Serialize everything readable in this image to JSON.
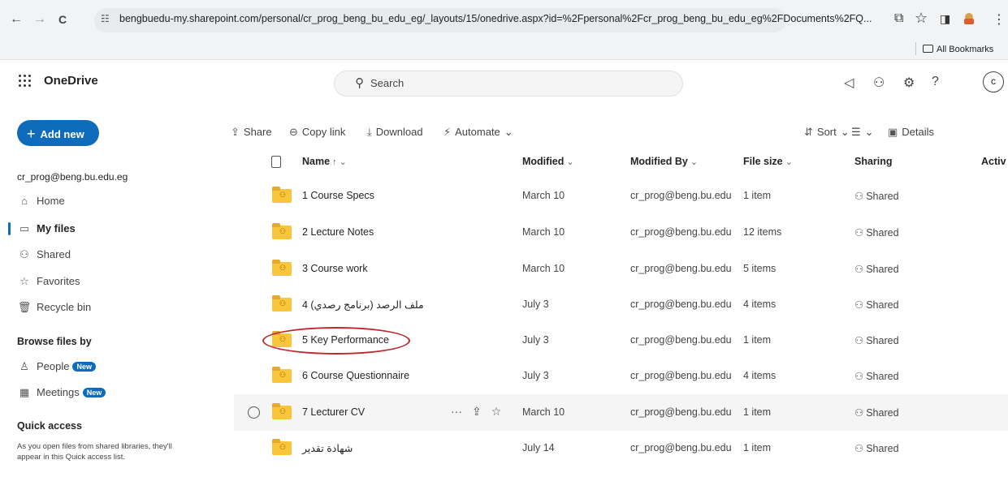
{
  "browser": {
    "back_icon": "←",
    "forward_icon": "→",
    "reload_icon": "C",
    "site_icon": "☷",
    "url": "bengbuedu-my.sharepoint.com/personal/cr_prog_beng_bu_edu_eg/_layouts/15/onedrive.aspx?id=%2Fpersonal%2Fcr_prog_beng_bu_edu_eg%2FDocuments%2FQ...",
    "star_icon": "☆",
    "bookmarks_label": "All Bookmarks"
  },
  "header": {
    "app_name": "OneDrive",
    "search_placeholder": "Search",
    "avatar_initial": "c",
    "icons": [
      "megaphone-icon",
      "people-icon",
      "gear-icon",
      "help-icon"
    ]
  },
  "sidebar": {
    "add_new": "Add new",
    "account": "cr_prog@beng.bu.edu.eg",
    "nav": [
      {
        "label": "Home",
        "icon": "⌂"
      },
      {
        "label": "My files",
        "icon": "▭"
      },
      {
        "label": "Shared",
        "icon": "⚇"
      },
      {
        "label": "Favorites",
        "icon": "☆"
      },
      {
        "label": "Recycle bin",
        "icon": "🗑"
      }
    ],
    "browse_heading": "Browse files by",
    "browse": [
      {
        "label": "People",
        "badge": "New"
      },
      {
        "label": "Meetings",
        "badge": "New"
      }
    ],
    "quick_heading": "Quick access",
    "quick_note": "As you open files from shared libraries, they'll appear in this Quick access list."
  },
  "commands": {
    "share": "Share",
    "copy_link": "Copy link",
    "download": "Download",
    "automate": "Automate",
    "sort": "Sort",
    "details": "Details"
  },
  "columns": {
    "name": "Name",
    "modified": "Modified",
    "modified_by": "Modified By",
    "file_size": "File size",
    "sharing": "Sharing",
    "activity": "Activ"
  },
  "files": [
    {
      "name": "1 Course Specs",
      "modified": "March 10",
      "modified_by": "cr_prog@beng.bu.edu",
      "size": "1 item",
      "sharing": "Shared"
    },
    {
      "name": "2 Lecture Notes",
      "modified": "March 10",
      "modified_by": "cr_prog@beng.bu.edu",
      "size": "12 items",
      "sharing": "Shared"
    },
    {
      "name": "3 Course work",
      "modified": "March 10",
      "modified_by": "cr_prog@beng.bu.edu",
      "size": "5 items",
      "sharing": "Shared"
    },
    {
      "name": "ملف الرصد (برنامج رصدي) 4",
      "modified": "July 3",
      "modified_by": "cr_prog@beng.bu.edu",
      "size": "4 items",
      "sharing": "Shared"
    },
    {
      "name": "5 Key Performance",
      "modified": "July 3",
      "modified_by": "cr_prog@beng.bu.edu",
      "size": "1 item",
      "sharing": "Shared"
    },
    {
      "name": "6 Course Questionnaire",
      "modified": "July 3",
      "modified_by": "cr_prog@beng.bu.edu",
      "size": "4 items",
      "sharing": "Shared"
    },
    {
      "name": "7 Lecturer CV",
      "modified": "March 10",
      "modified_by": "cr_prog@beng.bu.edu",
      "size": "1 item",
      "sharing": "Shared"
    },
    {
      "name": "شهادة تقدير",
      "modified": "July 14",
      "modified_by": "cr_prog@beng.bu.edu",
      "size": "1 item",
      "sharing": "Shared"
    }
  ],
  "hover_row_index": 6,
  "highlighted_row_index": 4,
  "colors": {
    "accent": "#0f6cbd",
    "folder": "#f8c53b",
    "highlight_oval": "#c0282e"
  }
}
